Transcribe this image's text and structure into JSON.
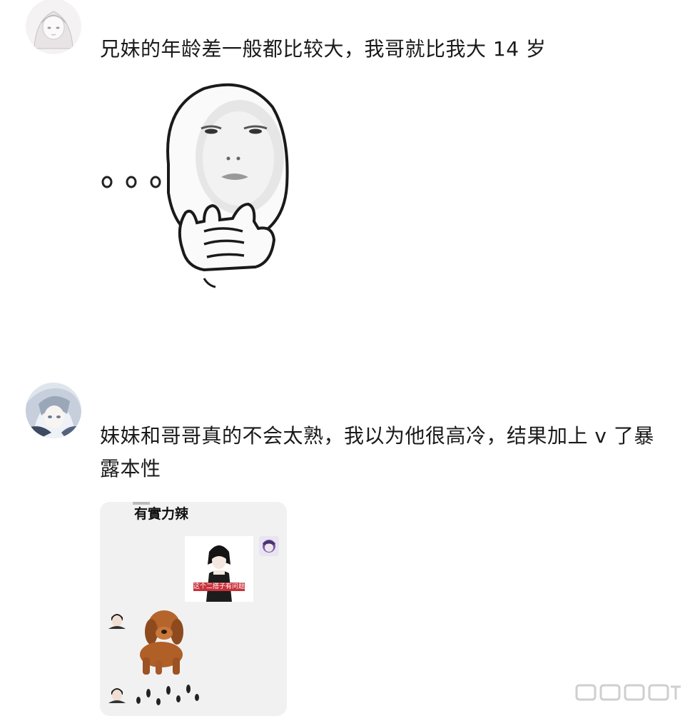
{
  "comments": [
    {
      "text": "兄妹的年龄差一般都比较大，我哥就比我大 14 岁",
      "avatar_icon": "anime-girl-avatar-icon",
      "sticker_icon": "thinking-face-meme-icon",
      "sticker_dots": "o o o"
    },
    {
      "text": "妹妹和哥哥真的不会太熟，我以为他很高冷，结果加上 v 了暴露本性",
      "avatar_icon": "anime-character-avatar-icon",
      "screenshot": {
        "title": "有實力辣",
        "card_caption": "这个二搭子有问题",
        "dog_icon": "dog-meme-icon"
      }
    }
  ],
  "colors": {
    "background": "#ffffff",
    "text": "#1a1a1a",
    "chat_bg": "#f1f1f1",
    "card_caption_bg": "#c8323c"
  }
}
